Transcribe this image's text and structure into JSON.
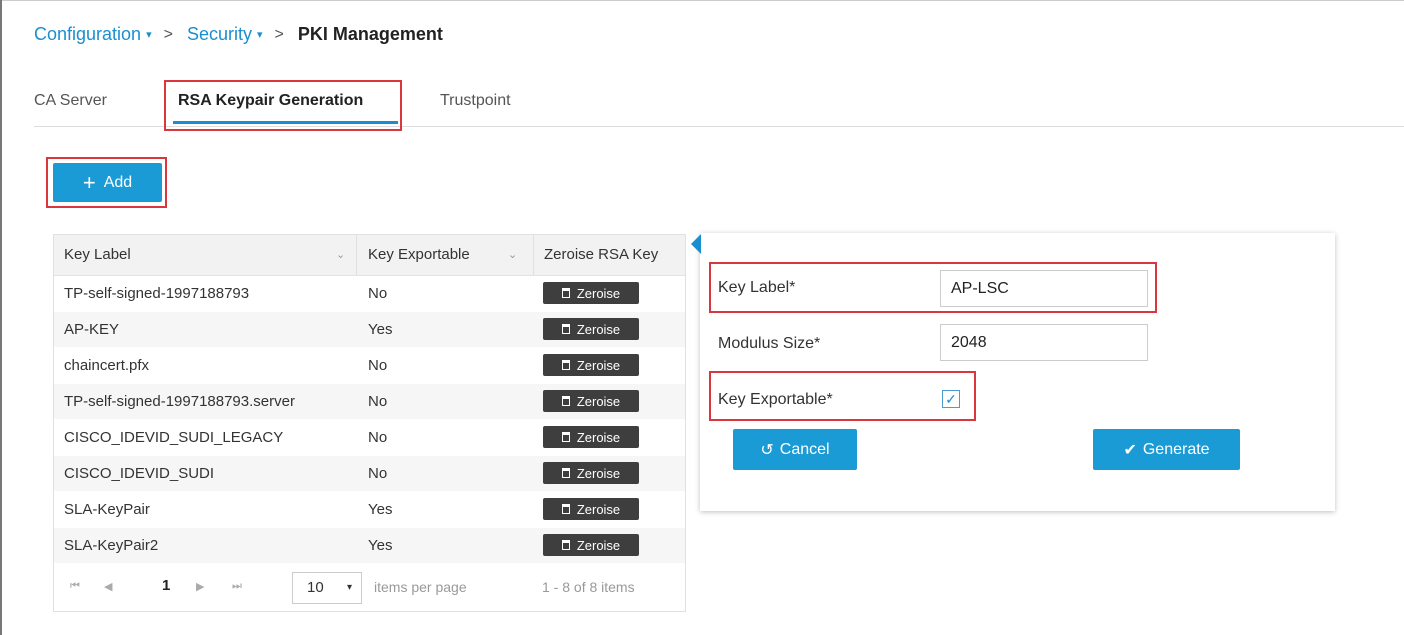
{
  "breadcrumb": {
    "items": [
      {
        "label": "Configuration",
        "caret": "▾"
      },
      {
        "label": "Security",
        "caret": "▾"
      }
    ],
    "separator": ">",
    "current": "PKI Management"
  },
  "tabs": [
    {
      "label": "CA Server",
      "active": false
    },
    {
      "label": "RSA Keypair Generation",
      "active": true
    },
    {
      "label": "Trustpoint",
      "active": false
    }
  ],
  "add_button": {
    "label": "Add",
    "icon": "plus-icon"
  },
  "table": {
    "columns": [
      "Key Label",
      "Key Exportable",
      "Zeroise RSA Key"
    ],
    "sort_glyph": "⌄",
    "zeroise_label": "Zeroise",
    "rows": [
      {
        "key_label": "TP-self-signed-1997188793",
        "exportable": "No"
      },
      {
        "key_label": "AP-KEY",
        "exportable": "Yes"
      },
      {
        "key_label": "chaincert.pfx",
        "exportable": "No"
      },
      {
        "key_label": "TP-self-signed-1997188793.server",
        "exportable": "No"
      },
      {
        "key_label": "CISCO_IDEVID_SUDI_LEGACY",
        "exportable": "No"
      },
      {
        "key_label": "CISCO_IDEVID_SUDI",
        "exportable": "No"
      },
      {
        "key_label": "SLA-KeyPair",
        "exportable": "Yes"
      },
      {
        "key_label": "SLA-KeyPair2",
        "exportable": "Yes"
      }
    ],
    "pager": {
      "first": "⏮",
      "prev": "◀",
      "next": "▶",
      "last": "⏭",
      "page": "1",
      "page_size": "10",
      "page_size_caret": "▾",
      "per_page_label": "items per page",
      "range_label": "1 - 8 of 8 items"
    }
  },
  "form": {
    "key_label": {
      "label": "Key Label*",
      "value": "AP-LSC"
    },
    "modulus_size": {
      "label": "Modulus Size*",
      "value": "2048"
    },
    "key_exportable": {
      "label": "Key Exportable*",
      "checked": true,
      "check_glyph": "✓"
    },
    "cancel": {
      "label": "Cancel",
      "icon": "↺"
    },
    "generate": {
      "label": "Generate",
      "icon": "✔"
    }
  },
  "colors": {
    "accent": "#1b9bd6",
    "highlight": "#d9363e",
    "dark_button": "#3e3e3e"
  }
}
